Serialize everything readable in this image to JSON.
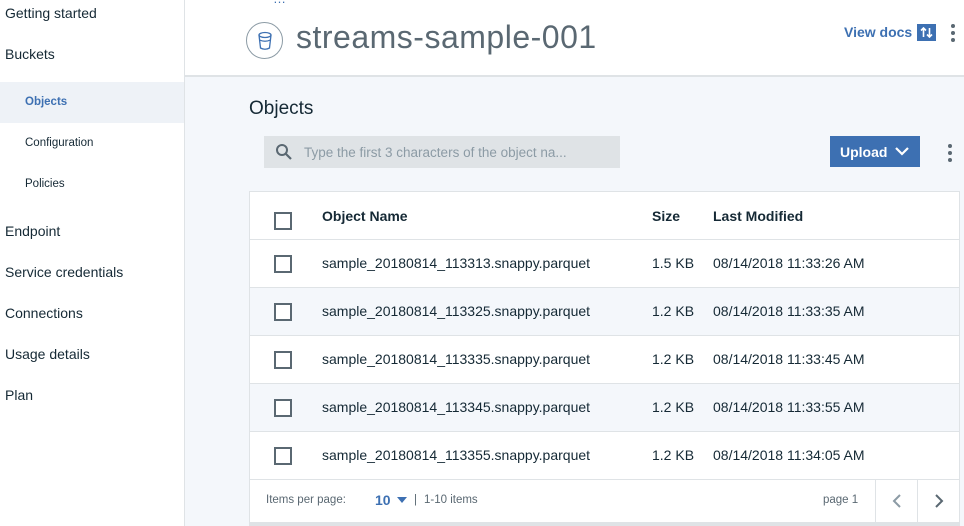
{
  "sidebar": {
    "items": [
      {
        "label": "Getting started"
      },
      {
        "label": "Buckets"
      },
      {
        "label": "Endpoint"
      },
      {
        "label": "Service credentials"
      },
      {
        "label": "Connections"
      },
      {
        "label": "Usage details"
      },
      {
        "label": "Plan"
      }
    ],
    "sub_items": [
      {
        "label": "Objects",
        "active": true
      },
      {
        "label": "Configuration"
      },
      {
        "label": "Policies"
      }
    ]
  },
  "header": {
    "breadcrumb_partial": "…",
    "title": "streams-sample-001",
    "view_docs": "View docs",
    "bucket_icon": "bucket-icon",
    "sort_icon": "sort-icon"
  },
  "main": {
    "section_title": "Objects",
    "search": {
      "placeholder": "Type the first 3 characters of the object na..."
    },
    "upload_label": "Upload",
    "table": {
      "columns": [
        "Object Name",
        "Size",
        "Last Modified"
      ],
      "rows": [
        {
          "name": "sample_20180814_113313.snappy.parquet",
          "size": "1.5 KB",
          "modified": "08/14/2018 11:33:26 AM"
        },
        {
          "name": "sample_20180814_113325.snappy.parquet",
          "size": "1.2 KB",
          "modified": "08/14/2018 11:33:35 AM"
        },
        {
          "name": "sample_20180814_113335.snappy.parquet",
          "size": "1.2 KB",
          "modified": "08/14/2018 11:33:45 AM"
        },
        {
          "name": "sample_20180814_113345.snappy.parquet",
          "size": "1.2 KB",
          "modified": "08/14/2018 11:33:55 AM"
        },
        {
          "name": "sample_20180814_113355.snappy.parquet",
          "size": "1.2 KB",
          "modified": "08/14/2018 11:34:05 AM"
        }
      ]
    },
    "pagination": {
      "items_per_page_label": "Items per page:",
      "items_per_page": "10",
      "separator": "|",
      "range": "1-10 items",
      "page": "page 1"
    }
  },
  "colors": {
    "accent": "#3d70b2",
    "text": "#152935",
    "muted": "#5a6872",
    "border": "#dfe3e6"
  }
}
